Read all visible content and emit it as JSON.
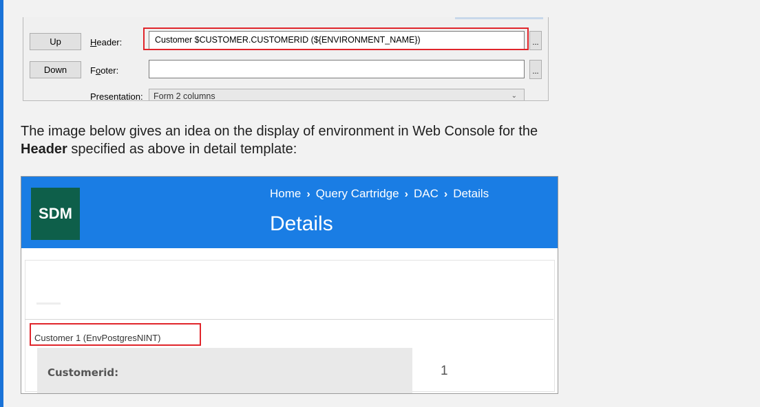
{
  "dialog": {
    "up_label": "Up",
    "down_label": "Down",
    "header_label_u": "H",
    "header_label_rest": "eader:",
    "footer_label_pre": "F",
    "footer_label_u": "o",
    "footer_label_rest": "oter:",
    "header_value": "Customer $CUSTOMER.CUSTOMERID (${ENVIRONMENT_NAME})",
    "footer_value": "",
    "ellipsis": "...",
    "presentation_label": "Presentation:",
    "presentation_value": "Form 2 columns"
  },
  "paragraph": {
    "line1": "The image below gives an idea on the display of environment in Web Console for the",
    "bold": "Header",
    "line2_rest": " specified as above in detail template:"
  },
  "console": {
    "logo": "SDM",
    "breadcrumbs": [
      "Home",
      "Query Cartridge",
      "DAC",
      "Details"
    ],
    "separator": "›",
    "heading": "Details",
    "customer_header": "Customer 1 (EnvPostgresNINT)",
    "field_label": "Customerid:",
    "field_value": "1"
  },
  "colors": {
    "accent_bar": "#1a73d8",
    "banner": "#1a7de4",
    "logo_bg": "#0e5f4a",
    "highlight": "#e0242a"
  }
}
